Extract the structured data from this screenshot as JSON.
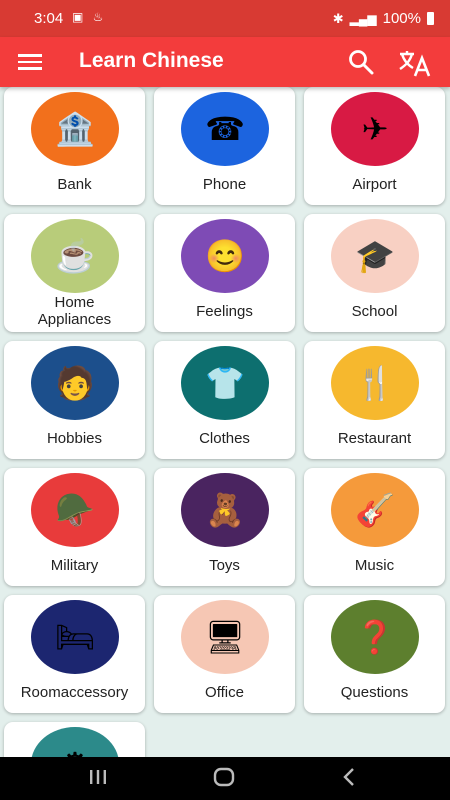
{
  "status": {
    "time": "3:04",
    "battery": "100%"
  },
  "app": {
    "title": "Learn Chinese"
  },
  "categories": [
    {
      "label": "Bank",
      "color": "#f2701c",
      "icon": "bank-icon",
      "glyph": "🏦"
    },
    {
      "label": "Phone",
      "color": "#1c64df",
      "icon": "phone-icon",
      "glyph": "☎"
    },
    {
      "label": "Airport",
      "color": "#d81a44",
      "icon": "airport-icon",
      "glyph": "✈"
    },
    {
      "label": "Home Appliances",
      "color": "#b8cc7a",
      "icon": "coffee-machine-icon",
      "glyph": "☕"
    },
    {
      "label": "Feelings",
      "color": "#7e4bb5",
      "icon": "faces-icon",
      "glyph": "😊"
    },
    {
      "label": "School",
      "color": "#f8d0c3",
      "icon": "books-icon",
      "glyph": "🎓"
    },
    {
      "label": "Hobbies",
      "color": "#1c4f8c",
      "icon": "hobbies-icon",
      "glyph": "🧑"
    },
    {
      "label": "Clothes",
      "color": "#0d6f6f",
      "icon": "clothes-icon",
      "glyph": "👕"
    },
    {
      "label": "Restaurant",
      "color": "#f6b82e",
      "icon": "restaurant-icon",
      "glyph": "🍴"
    },
    {
      "label": "Military",
      "color": "#e83b3b",
      "icon": "soldier-icon",
      "glyph": "🪖"
    },
    {
      "label": "Toys",
      "color": "#4a2460",
      "icon": "toys-icon",
      "glyph": "🧸"
    },
    {
      "label": "Music",
      "color": "#f59a3b",
      "icon": "guitar-icon",
      "glyph": "🎸"
    },
    {
      "label": "Roomaccessory",
      "color": "#1c2670",
      "icon": "bed-icon",
      "glyph": "🛏"
    },
    {
      "label": "Office",
      "color": "#f6c7b4",
      "icon": "desk-icon",
      "glyph": "🖥"
    },
    {
      "label": "Questions",
      "color": "#5d7f2e",
      "icon": "question-chat-icon",
      "glyph": "❓"
    },
    {
      "label": "",
      "color": "#2c8a8a",
      "icon": "settings-icon",
      "glyph": "⚙"
    }
  ]
}
